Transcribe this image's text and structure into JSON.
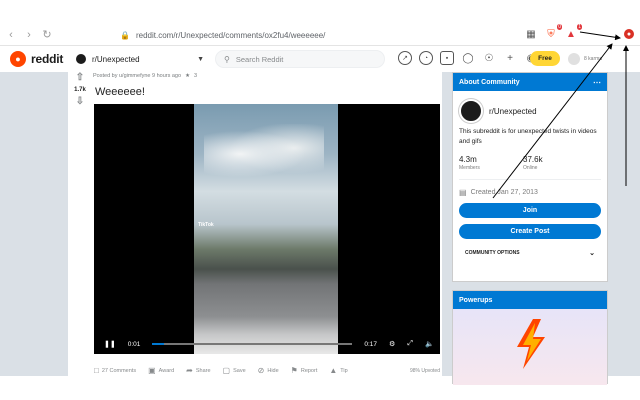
{
  "browser": {
    "url": "reddit.com/r/Unexpected/comments/ox2fu4/weeeeee/",
    "back_icon": "back-arrow-icon",
    "forward_icon": "forward-arrow-icon",
    "reload_icon": "reload-icon",
    "badge_brave": "0",
    "badge_bat": "1"
  },
  "header": {
    "wordmark": "reddit",
    "community": "r/Unexpected",
    "search_placeholder": "Search Reddit",
    "free_label": "Free",
    "user_label": "8 karma"
  },
  "post": {
    "score": "1.7k",
    "meta": "Posted by u/gimmefyne 9 hours ago",
    "award_count": "3",
    "title": "Weeeeee!",
    "video": {
      "watermark": "TikTok",
      "current_time": "0:01",
      "duration": "0:17",
      "progress_pct": 6
    },
    "actions": {
      "comments": "27 Comments",
      "award": "Award",
      "share": "Share",
      "save": "Save",
      "hide": "Hide",
      "report": "Report",
      "tip": "Tip",
      "upvoted": "98% Upvoted"
    }
  },
  "sidebar": {
    "about_title": "About Community",
    "community_name": "r/Unexpected",
    "description": "This subreddit is for unexpected twists in videos and gifs",
    "members_count": "4.3m",
    "members_label": "Members",
    "online_count": "37.6k",
    "online_label": "Online",
    "created": "Created Jan 27, 2013",
    "join_label": "Join",
    "create_post_label": "Create Post",
    "options_label": "COMMUNITY OPTIONS",
    "powerups_title": "Powerups"
  },
  "colors": {
    "brand": "#ff4500",
    "accent": "#0079d3",
    "free_badge": "#ffd635",
    "background": "#dae0e6"
  }
}
